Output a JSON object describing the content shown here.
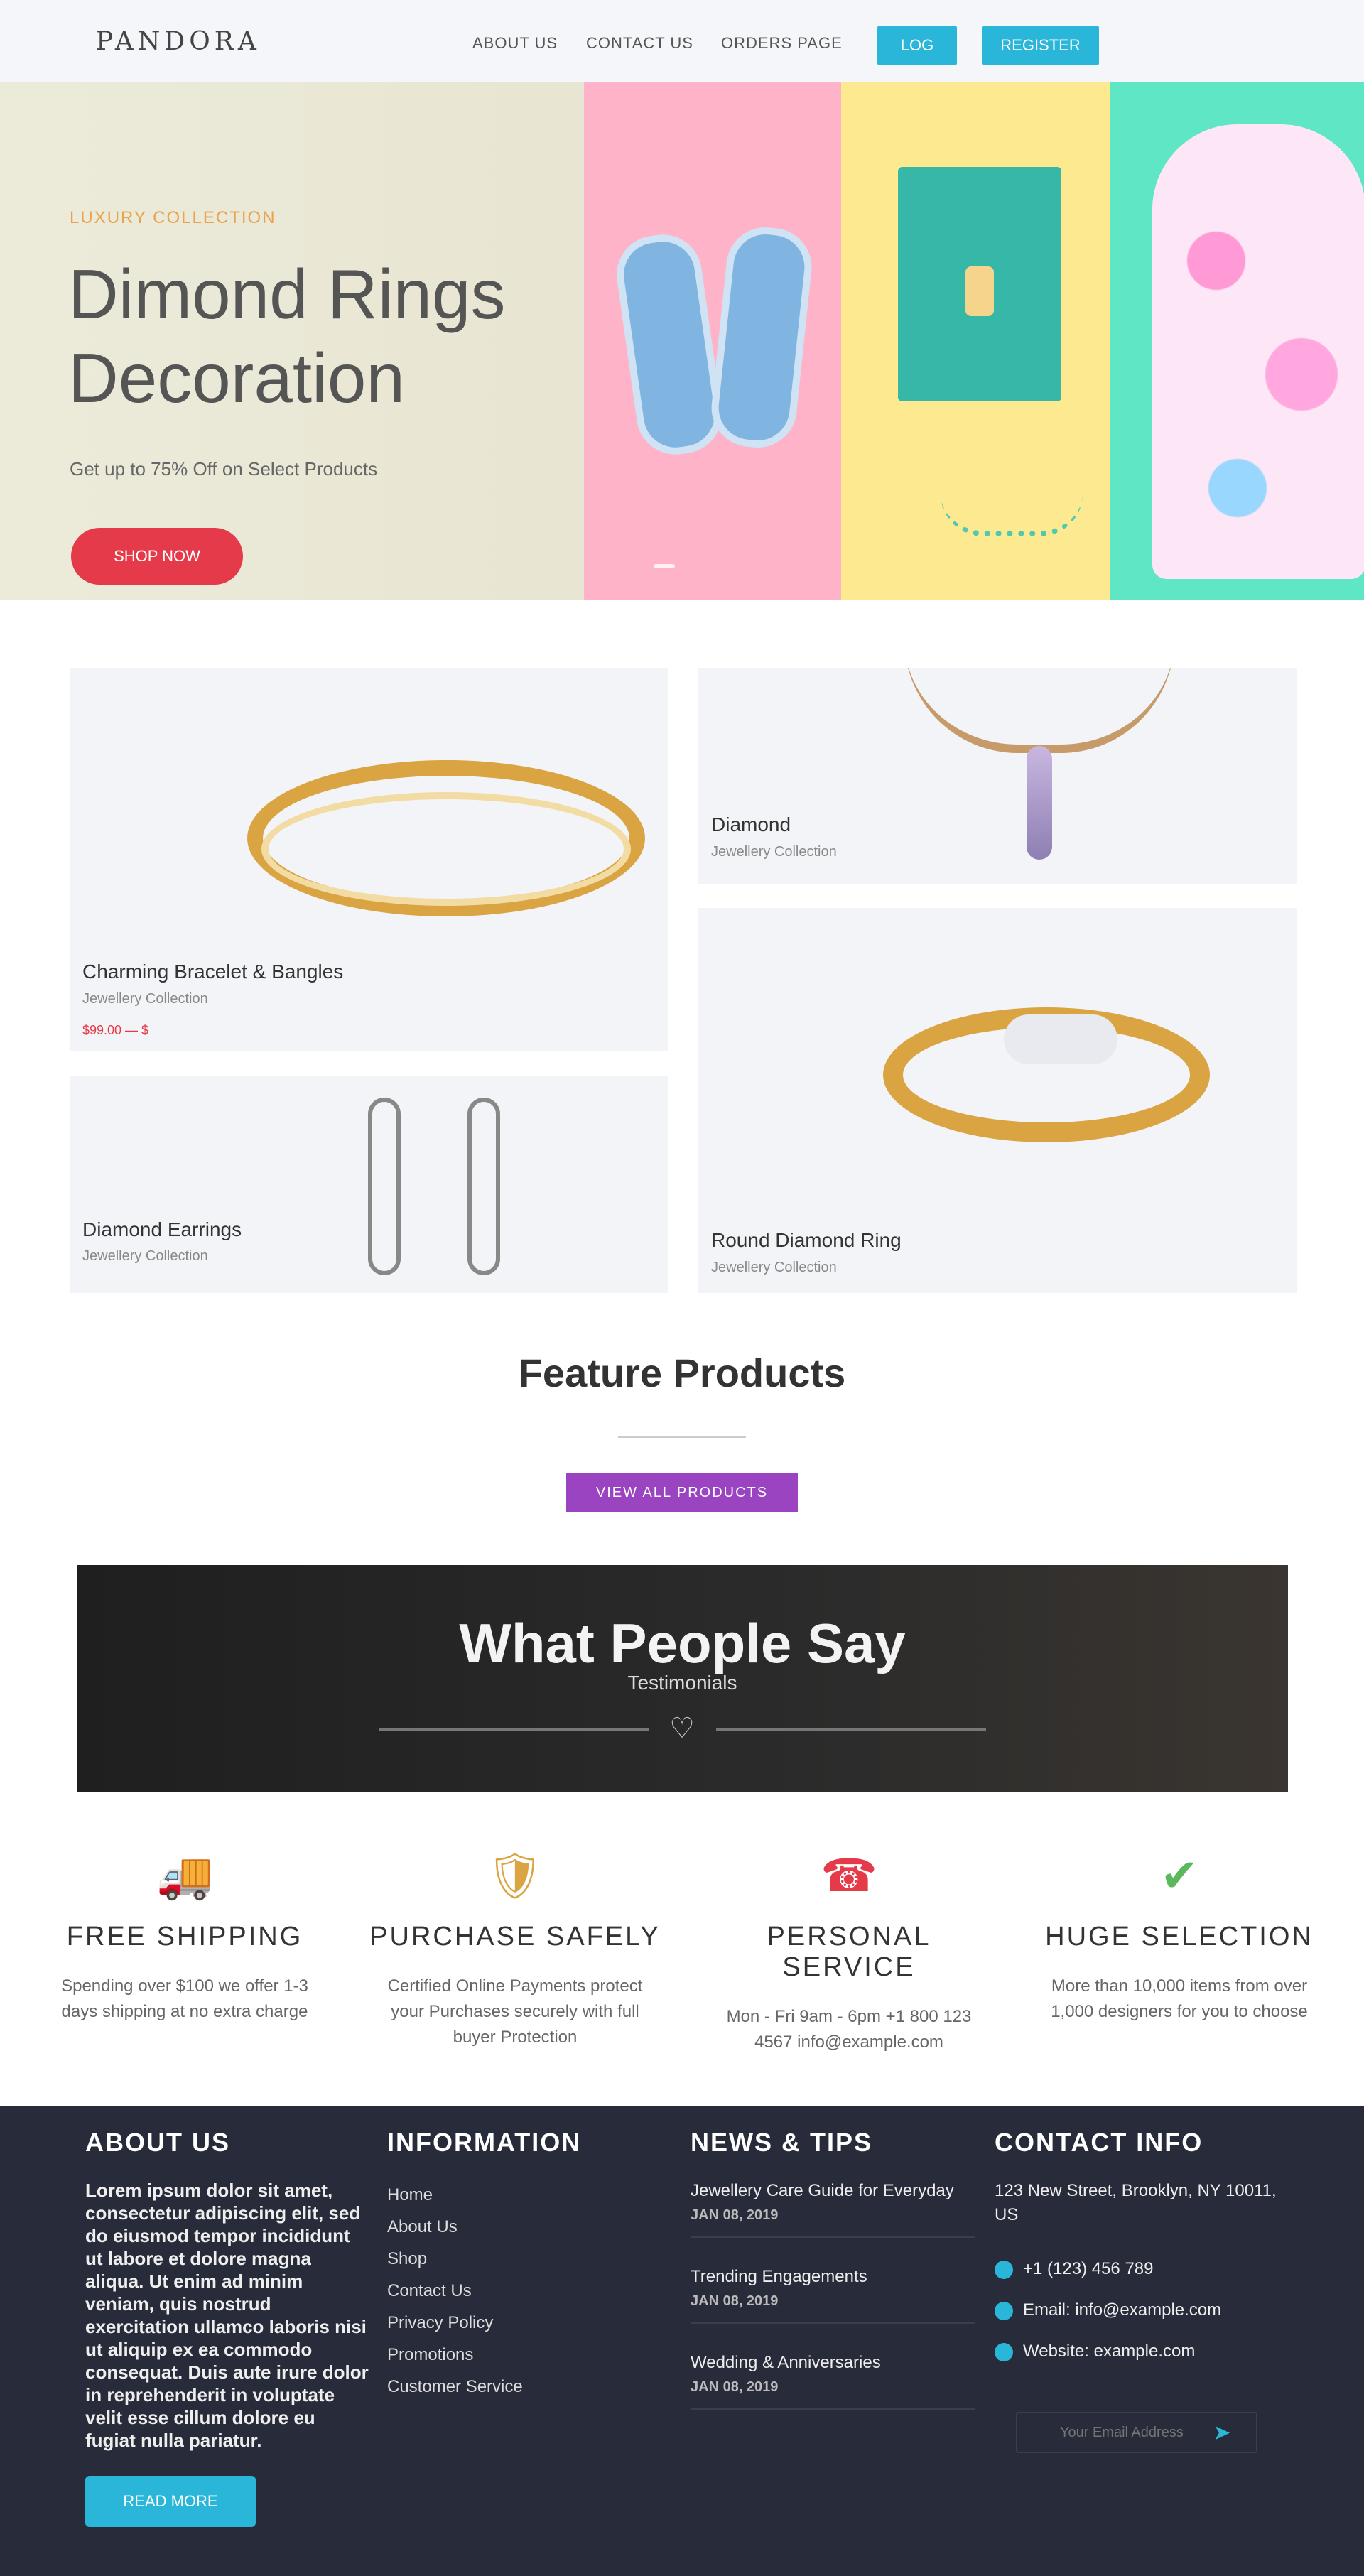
{
  "header": {
    "logo": "PANDORA",
    "nav": [
      "ABOUT US",
      "CONTACT US",
      "ORDERS PAGE"
    ],
    "buttons": [
      "LOG",
      "REGISTER"
    ]
  },
  "hero": {
    "kicker": "LUXURY COLLECTION",
    "title": "Dimond Rings Decoration",
    "subtitle": "Get up to 75% Off on Select Products",
    "button": "SHOP NOW"
  },
  "products": [
    {
      "name": "Charming Bracelet & Bangles",
      "sub": "Jewellery Collection",
      "price": "$99.00 — $"
    },
    {
      "name": "Diamond",
      "sub": "Jewellery Collection"
    },
    {
      "name": "Diamond Earrings",
      "sub": "Jewellery Collection"
    },
    {
      "name": "Round Diamond Ring",
      "sub": "Jewellery Collection"
    }
  ],
  "feature": {
    "title": "Feature Products",
    "button": "VIEW ALL PRODUCTS"
  },
  "testimonial": {
    "title": "What People Say",
    "subtitle": "Testimonials"
  },
  "services": [
    {
      "title": "FREE SHIPPING",
      "desc": "Spending over $100 we offer 1-3 days shipping at no extra charge",
      "icon": "truck-icon"
    },
    {
      "title": "PURCHASE SAFELY",
      "desc": "Certified Online Payments protect your Purchases securely with full buyer Protection",
      "icon": "shield-icon"
    },
    {
      "title": "PERSONAL SERVICE",
      "desc": "Mon - Fri 9am - 6pm +1 800 123 4567 info@example.com",
      "icon": "phone-icon"
    },
    {
      "title": "HUGE SELECTION",
      "desc": "More than 10,000 items from over 1,000 designers for you to choose",
      "icon": "check-icon"
    }
  ],
  "footer": {
    "about": {
      "heading": "ABOUT US",
      "text": "Lorem ipsum dolor sit amet, consectetur adipiscing elit, sed do eiusmod tempor incididunt ut labore et dolore magna aliqua. Ut enim ad minim veniam, quis nostrud exercitation ullamco laboris nisi ut aliquip ex ea commodo consequat. Duis aute irure dolor in reprehenderit in voluptate velit esse cillum dolore eu fugiat nulla pariatur.",
      "button": "READ MORE"
    },
    "information": {
      "heading": "INFORMATION",
      "links": [
        "Home",
        "About Us",
        "Shop",
        "Contact Us",
        "Privacy Policy",
        "Promotions",
        "Customer Service"
      ]
    },
    "news": {
      "heading": "NEWS & TIPS",
      "items": [
        {
          "title": "Jewellery Care Guide for Everyday",
          "date": "JAN 08, 2019"
        },
        {
          "title": "Trending Engagements",
          "date": "JAN 08, 2019"
        },
        {
          "title": "Wedding & Anniversaries",
          "date": "JAN 08, 2019"
        }
      ]
    },
    "contact": {
      "heading": "CONTACT INFO",
      "address": "123 New Street, Brooklyn, NY 10011, US",
      "phone": "+1 (123) 456 789",
      "email": "Email: info@example.com",
      "web": "Website: example.com",
      "search_placeholder": "Your Email Address"
    }
  },
  "colors": {
    "accent": "#2ab6d8",
    "hero_button": "#e53a4a",
    "feature_button": "#9b44c2",
    "footer_bg": "#282c3a"
  }
}
